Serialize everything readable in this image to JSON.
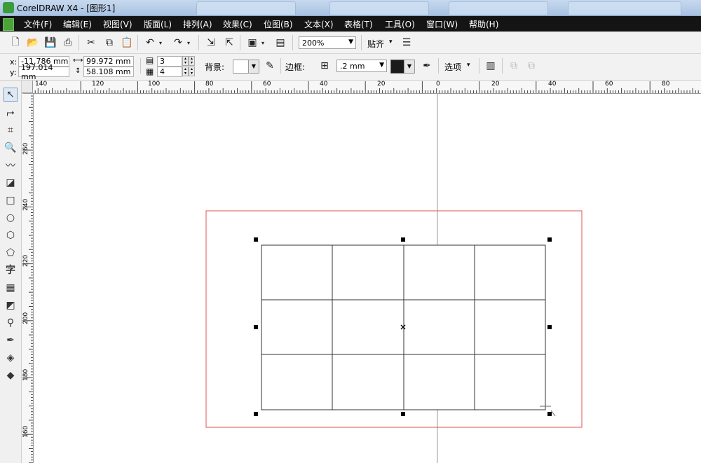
{
  "window": {
    "title": "CorelDRAW X4 - [图形1]"
  },
  "menu": {
    "items": [
      {
        "label": "文件(F)"
      },
      {
        "label": "编辑(E)"
      },
      {
        "label": "视图(V)"
      },
      {
        "label": "版面(L)"
      },
      {
        "label": "排列(A)"
      },
      {
        "label": "效果(C)"
      },
      {
        "label": "位图(B)"
      },
      {
        "label": "文本(X)"
      },
      {
        "label": "表格(T)"
      },
      {
        "label": "工具(O)"
      },
      {
        "label": "窗口(W)"
      },
      {
        "label": "帮助(H)"
      }
    ]
  },
  "toolbar": {
    "zoom_value": "200%",
    "snap_label": "贴齐",
    "icons": [
      "new-icon",
      "open-icon",
      "save-icon",
      "print-icon",
      "cut-icon",
      "copy-icon",
      "paste-icon",
      "undo-icon",
      "redo-icon",
      "import-icon",
      "export-icon",
      "launcher-icon",
      "welcome-icon",
      "options-icon"
    ]
  },
  "property_bar": {
    "x_label": "x:",
    "x_value": "-11.786 mm",
    "y_label": "y:",
    "y_value": "197.014 mm",
    "width_value": "99.972 mm",
    "height_value": "58.108 mm",
    "rows_value": "3",
    "cols_value": "4",
    "background_label": "背景:",
    "border_label": "边框:",
    "border_width_value": ".2 mm",
    "options_label": "选项"
  },
  "rulers": {
    "horizontal_labels": [
      "140",
      "120",
      "100",
      "80",
      "60",
      "40",
      "20",
      "0",
      "20",
      "40",
      "60",
      "80"
    ],
    "vertical_labels": [
      "260",
      "240",
      "220",
      "200",
      "180",
      "160"
    ]
  },
  "table_object": {
    "rows": 3,
    "cols": 4
  },
  "colors": {
    "menu_bg": "#141414",
    "selection_frame": "#e05050",
    "table_line": "#333333"
  }
}
